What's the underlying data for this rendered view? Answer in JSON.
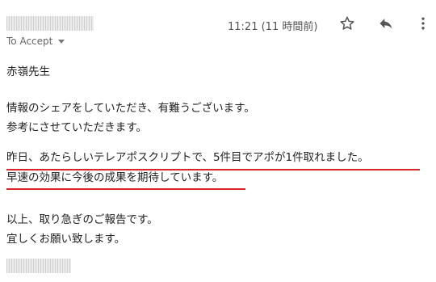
{
  "header": {
    "time_text": "11:21 (11 時間前)",
    "to_label": "To Accept"
  },
  "icons": {
    "star": "star-icon",
    "reply": "reply-icon",
    "more": "more-vertical-icon",
    "recipients": "chevron-down-icon"
  },
  "body": {
    "greeting": "赤嶺先生",
    "thanks": "情報のシェアをしていただき、有難うございます。",
    "reference": "参考にさせていただきます。",
    "result": "昨日、あたらしいテレアポスクリプトで、5件目でアポが1件取れました。",
    "expectation": "早速の効果に今後の成果を期待しています。",
    "closing_1": "以上、取り急ぎのご報告です。",
    "closing_2": "宜しくお願い致します。"
  },
  "colors": {
    "underline": "#d9262b",
    "redaction": "#d6d6d6"
  }
}
